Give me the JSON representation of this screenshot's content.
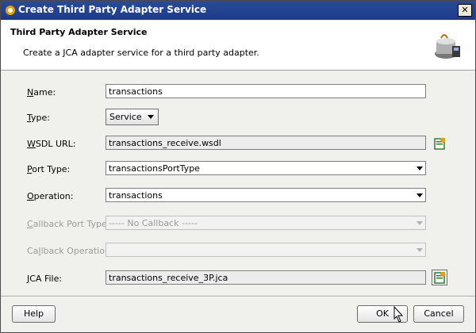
{
  "window": {
    "title": "Create Third Party Adapter Service",
    "close_glyph": "✕"
  },
  "header": {
    "title": "Third Party Adapter Service",
    "description": "Create a JCA adapter service for a third party adapter."
  },
  "form": {
    "name": {
      "label_u": "N",
      "label_rest": "ame:",
      "value": "transactions"
    },
    "type": {
      "label_u": "T",
      "label_rest": "ype:",
      "value": "Service"
    },
    "wsdl": {
      "label_u": "W",
      "label_rest": "SDL URL:",
      "value": "transactions_receive.wsdl"
    },
    "port_type": {
      "label_u": "P",
      "label_rest": "ort Type:",
      "value": "transactionsPortType"
    },
    "operation": {
      "label_u": "O",
      "label_rest": "peration:",
      "value": "transactions"
    },
    "callback_port_type": {
      "label_u": "C",
      "label_rest": "allback Port Type:",
      "value": "----- No Callback -----"
    },
    "callback_operation": {
      "label_pre": "Ca",
      "label_u": "l",
      "label_rest": "lback Operation:",
      "value": ""
    },
    "jca_file": {
      "label_u": "J",
      "label_rest": "CA File:",
      "value": "transactions_receive_3P.jca"
    }
  },
  "buttons": {
    "help": "Help",
    "ok": "OK",
    "cancel": "Cancel"
  },
  "colors": {
    "titlebar": "#1d3a8a",
    "accent_icon": "#2e7d32"
  }
}
